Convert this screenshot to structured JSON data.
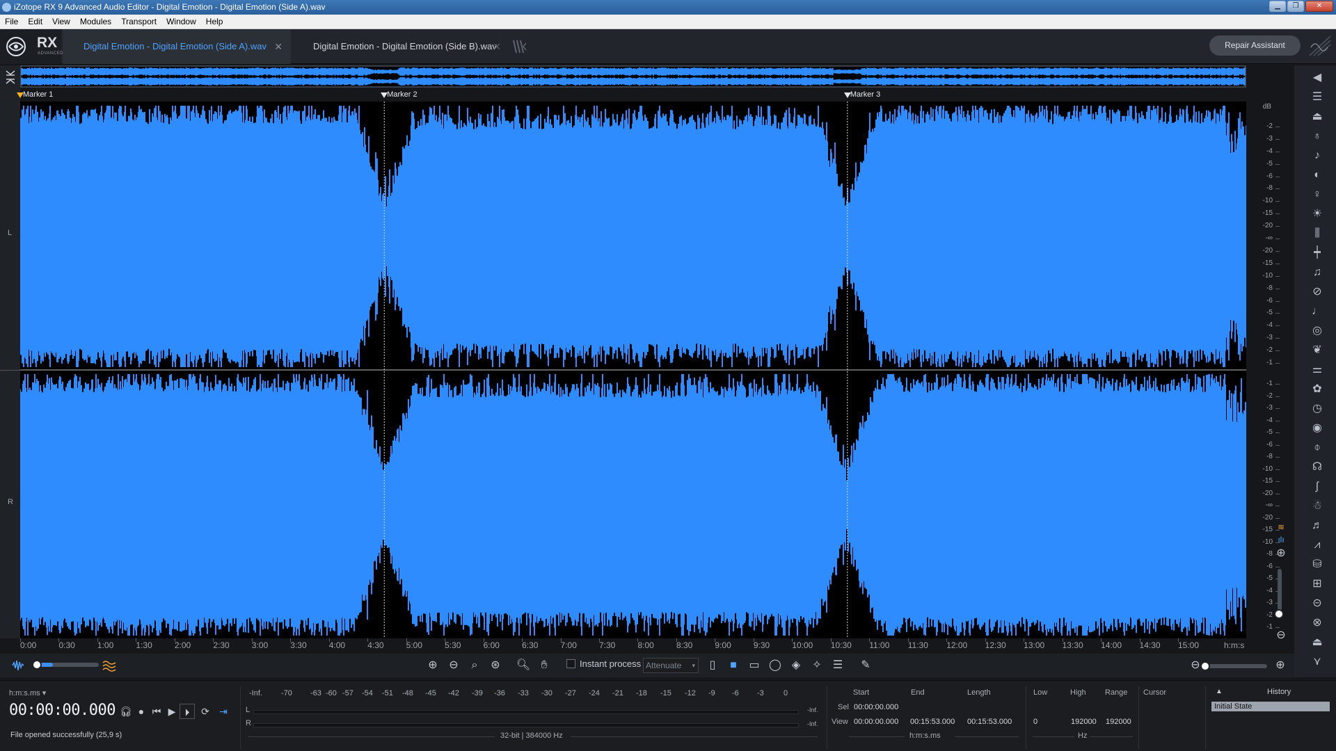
{
  "window": {
    "title": "iZotope RX 9 Advanced Audio Editor - Digital Emotion - Digital Emotion (Side A).wav"
  },
  "menu": [
    "File",
    "Edit",
    "View",
    "Modules",
    "Transport",
    "Window",
    "Help"
  ],
  "app": {
    "logo_text": "RX",
    "logo_sub": "ADVANCED"
  },
  "tabs": [
    {
      "label": "Digital Emotion - Digital Emotion (Side A).wav",
      "active": true
    },
    {
      "label": "Digital Emotion - Digital Emotion (Side B).wav",
      "active": false
    }
  ],
  "repair_assistant_label": "Repair Assistant",
  "markers": [
    {
      "label": "Marker 1",
      "time_s": 0
    },
    {
      "label": "Marker 2",
      "time_s": 283
    },
    {
      "label": "Marker 3",
      "time_s": 643
    }
  ],
  "channels": {
    "left": "L",
    "right": "R"
  },
  "db_unit": "dB",
  "db_ticks_left": [
    "-2",
    "-3",
    "-4",
    "-5",
    "-6",
    "-8",
    "-10",
    "-15",
    "-20",
    "-∞",
    "-20",
    "-15",
    "-10",
    "-8",
    "-6",
    "-5",
    "-4",
    "-3",
    "-2",
    "-1"
  ],
  "db_ticks_right": [
    "-1",
    "-2",
    "-3",
    "-4",
    "-5",
    "-6",
    "-8",
    "-10",
    "-15",
    "-20",
    "-∞",
    "-20",
    "-15",
    "-10",
    "-8",
    "-6",
    "-5",
    "-4",
    "-3",
    "-2",
    "-1"
  ],
  "timeline": {
    "labels": [
      "0:00",
      "0:30",
      "1:00",
      "1:30",
      "2:00",
      "2:30",
      "3:00",
      "3:30",
      "4:00",
      "4:30",
      "5:00",
      "5:30",
      "6:00",
      "6:30",
      "7:00",
      "7:30",
      "8:00",
      "8:30",
      "9:00",
      "9:30",
      "10:00",
      "10:30",
      "11:00",
      "11:30",
      "12:00",
      "12:30",
      "13:00",
      "13:30",
      "14:00",
      "14:30",
      "15:00"
    ],
    "unit": "h:m:s",
    "total_s": 953
  },
  "toolbar": {
    "instant_process_label": "Instant process",
    "instant_process_checked": false,
    "mode_value": "Attenuate",
    "zoom_level": 0.0
  },
  "time_format": "h:m:s.ms",
  "timecode": "00:00:00.000",
  "status": "File opened successfully (25,9 s)",
  "meter": {
    "scale": [
      "-Inf.",
      "-70",
      "-63",
      "-60",
      "-57",
      "-54",
      "-51",
      "-48",
      "-45",
      "-42",
      "-39",
      "-36",
      "-33",
      "-30",
      "-27",
      "-24",
      "-21",
      "-18",
      "-15",
      "-12",
      "-9",
      "-6",
      "-3",
      "0"
    ],
    "channels": [
      "L",
      "R"
    ],
    "peak_l": "-Inf.",
    "peak_r": "-Inf.",
    "format": "32-bit | 384000 Hz"
  },
  "selection": {
    "headers": [
      "Start",
      "End",
      "Length"
    ],
    "sel_label": "Sel",
    "view_label": "View",
    "sel_start": "00:00:00.000",
    "view_start": "00:00:00.000",
    "view_end": "00:15:53.000",
    "view_length": "00:15:53.000",
    "time_unit": "h:m:s.ms"
  },
  "frequency": {
    "headers": [
      "Low",
      "High",
      "Range"
    ],
    "low": "0",
    "high": "192000",
    "range": "192000",
    "unit": "Hz"
  },
  "cursor_label": "Cursor",
  "history": {
    "title": "History",
    "items": [
      "Initial State"
    ]
  },
  "colors": {
    "waveform": "#2f8cff",
    "background": "#000000",
    "accent": "#4ea3ff",
    "marker1": "#ffb020"
  }
}
